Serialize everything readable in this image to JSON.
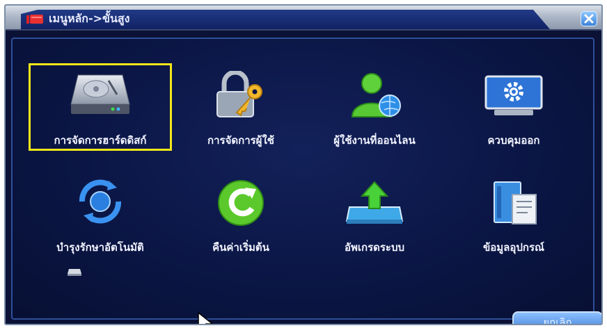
{
  "window": {
    "title": "เมนูหลัก->ขั้นสูง",
    "close_icon": "close-x-icon",
    "accent_color": "#f3e71a"
  },
  "menu": {
    "items": [
      {
        "label": "การจัดการฮาร์ดดิสก์",
        "icon": "hard-disk-icon",
        "selected": true
      },
      {
        "label": "การจัดการผู้ใช้",
        "icon": "lock-key-icon",
        "selected": false
      },
      {
        "label": "ผู้ใช้งานที่ออนไลน",
        "icon": "online-user-icon",
        "selected": false
      },
      {
        "label": "ควบคุมออก",
        "icon": "output-control-icon",
        "selected": false
      },
      {
        "label": "บำรุงรักษาอัตโนมัติ",
        "icon": "auto-maintain-icon",
        "selected": false
      },
      {
        "label": "คืนค่าเริ่มต้น",
        "icon": "restore-default-icon",
        "selected": false
      },
      {
        "label": "อัพเกรดระบบ",
        "icon": "system-upgrade-icon",
        "selected": false
      },
      {
        "label": "ข้อมูลอุปกรณ์",
        "icon": "device-info-icon",
        "selected": false
      }
    ]
  },
  "footer": {
    "cancel_label": "ยกเลิก"
  }
}
